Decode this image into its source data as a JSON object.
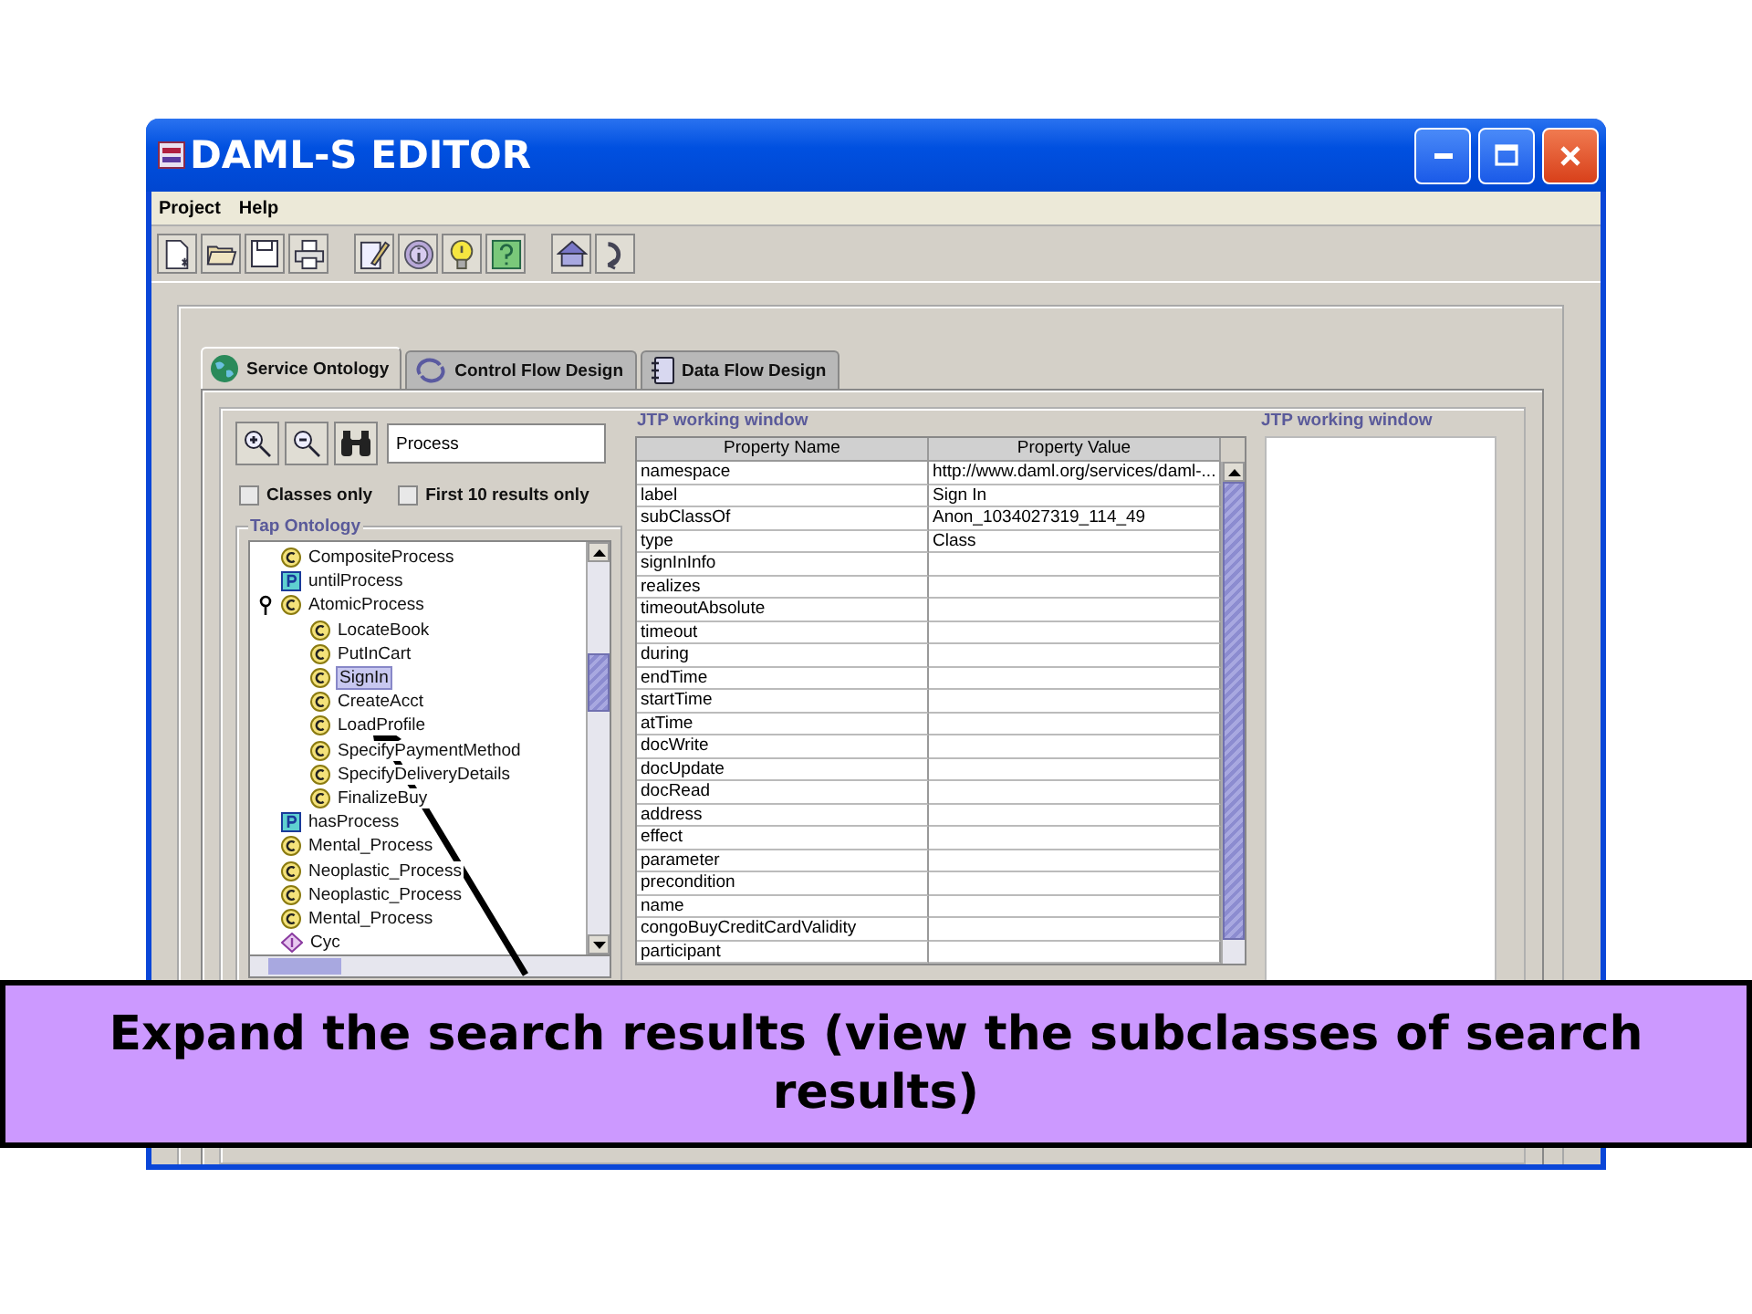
{
  "window": {
    "title": "DAML-S EDITOR"
  },
  "menu": [
    "Project",
    "Help"
  ],
  "tabs": [
    {
      "label": "Service Ontology",
      "selected": true
    },
    {
      "label": "Control Flow Design",
      "selected": false
    },
    {
      "label": "Data Flow Design",
      "selected": false
    }
  ],
  "search": {
    "value": "Process"
  },
  "options": [
    {
      "label": "Classes only",
      "checked": false
    },
    {
      "label": "First 10 results only",
      "checked": false
    }
  ],
  "tree": {
    "title": "Tap Ontology",
    "items": [
      {
        "kind": "class",
        "label": "CompositeProcess",
        "selected": false
      },
      {
        "kind": "property",
        "label": "untilProcess",
        "selected": false
      },
      {
        "kind": "class",
        "label": "AtomicProcess",
        "selected": false,
        "expanded": true,
        "children": [
          {
            "kind": "class",
            "label": "LocateBook",
            "selected": false
          },
          {
            "kind": "class",
            "label": "PutInCart",
            "selected": false
          },
          {
            "kind": "class",
            "label": "SignIn",
            "selected": true
          },
          {
            "kind": "class",
            "label": "CreateAcct",
            "selected": false
          },
          {
            "kind": "class",
            "label": "LoadProfile",
            "selected": false
          },
          {
            "kind": "class",
            "label": "SpecifyPaymentMethod",
            "selected": false
          },
          {
            "kind": "class",
            "label": "SpecifyDeliveryDetails",
            "selected": false
          },
          {
            "kind": "class",
            "label": "FinalizeBuy",
            "selected": false
          }
        ]
      },
      {
        "kind": "property",
        "label": "hasProcess",
        "selected": false
      },
      {
        "kind": "class",
        "label": "Mental_Process",
        "selected": false
      },
      {
        "kind": "class",
        "label": "Neoplastic_Process",
        "selected": false
      },
      {
        "kind": "class",
        "label": "Neoplastic_Process",
        "selected": false
      },
      {
        "kind": "class",
        "label": "Mental_Process",
        "selected": false
      },
      {
        "kind": "ontology",
        "label": "Cyc",
        "selected": false
      }
    ]
  },
  "properties": {
    "title": "JTP working window",
    "columns": [
      "Property Name",
      "Property Value"
    ],
    "rows": [
      {
        "name": "namespace",
        "value": "http://www.daml.org/services/daml-..."
      },
      {
        "name": "label",
        "value": "Sign In"
      },
      {
        "name": "subClassOf",
        "value": "Anon_1034027319_114_49"
      },
      {
        "name": "type",
        "value": "Class"
      },
      {
        "name": "signInInfo"
      },
      {
        "name": "realizes"
      },
      {
        "name": "timeoutAbsolute"
      },
      {
        "name": "timeout"
      },
      {
        "name": "during"
      },
      {
        "name": "endTime"
      },
      {
        "name": "startTime"
      },
      {
        "name": "atTime"
      },
      {
        "name": "docWrite"
      },
      {
        "name": "docUpdate"
      },
      {
        "name": "docRead"
      },
      {
        "name": "address"
      },
      {
        "name": "effect"
      },
      {
        "name": "parameter"
      },
      {
        "name": "precondition"
      },
      {
        "name": "name"
      },
      {
        "name": "congoBuyCreditCardValidity"
      },
      {
        "name": "participant"
      }
    ]
  },
  "working_window": {
    "title": "JTP working window"
  },
  "caption": "Expand the search results (view the subclasses of search results)"
}
